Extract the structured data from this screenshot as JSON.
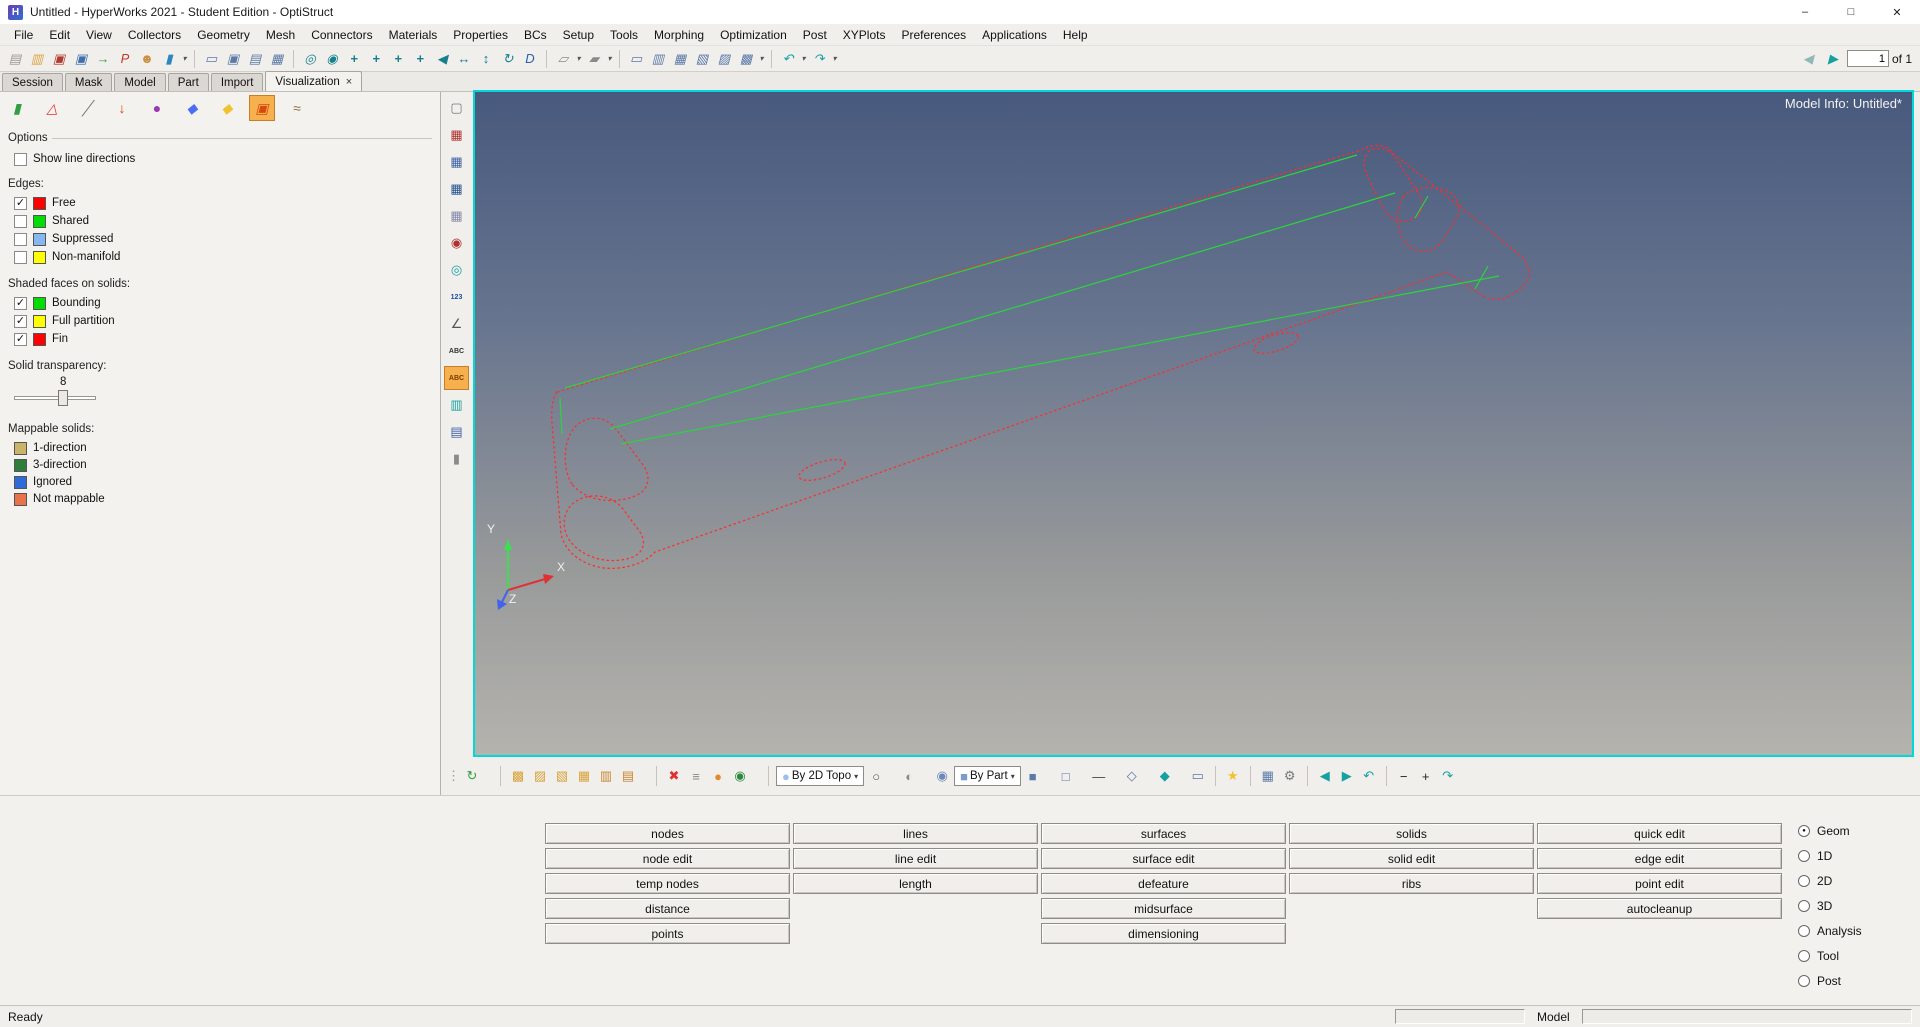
{
  "window": {
    "title": "Untitled - HyperWorks 2021 - Student Edition - OptiStruct",
    "controls": {
      "minimize": "–",
      "maximize": "□",
      "close": "✕"
    }
  },
  "menu": {
    "items": [
      "File",
      "Edit",
      "View",
      "Collectors",
      "Geometry",
      "Mesh",
      "Connectors",
      "Materials",
      "Properties",
      "BCs",
      "Setup",
      "Tools",
      "Morphing",
      "Optimization",
      "Post",
      "XYPlots",
      "Preferences",
      "Applications",
      "Help"
    ]
  },
  "toolbar": {
    "icons": [
      {
        "n": "new-session-icon",
        "g": "▤",
        "c": "#9a9791"
      },
      {
        "n": "open-model-icon",
        "g": "▥",
        "c": "#d9a33b"
      },
      {
        "n": "save-model-icon",
        "g": "▣",
        "c": "#b23a2e"
      },
      {
        "n": "save-as-icon",
        "g": "▣",
        "c": "#3f6fae"
      },
      {
        "n": "import-solver-deck-icon",
        "g": "→",
        "c": "#2f9e44"
      },
      {
        "n": "export-ppt-icon",
        "g": "P",
        "c": "#c0392b"
      },
      {
        "n": "user-profiles-icon",
        "g": "☻",
        "c": "#c98e3f"
      },
      {
        "n": "report-icon",
        "g": "▮",
        "c": "#2e86c1"
      },
      {
        "n": "dropdown-caret",
        "g": "▾",
        "c": "#555",
        "cls": "caret"
      },
      {
        "n": "separator",
        "cls": "sep",
        "ia": "false"
      },
      {
        "n": "copy-window-icon",
        "g": "▭",
        "c": "#5b7aa8"
      },
      {
        "n": "capture-screen-icon",
        "g": "▣",
        "c": "#5b7aa8"
      },
      {
        "n": "screen-grab-icon",
        "g": "▤",
        "c": "#5b7aa8"
      },
      {
        "n": "print-icon",
        "g": "▦",
        "c": "#5b7aa8"
      },
      {
        "n": "separator",
        "cls": "sep",
        "ia": "false"
      },
      {
        "n": "zoom-icon",
        "g": "◎",
        "c": "#16808c"
      },
      {
        "n": "smooth-zoom-icon",
        "g": "◉",
        "c": "#16808c"
      },
      {
        "n": "view-normal-icon",
        "g": "+",
        "c": "#16808c",
        "cls": "bold"
      },
      {
        "n": "view-top-icon",
        "g": "+",
        "c": "#16808c",
        "cls": "bold"
      },
      {
        "n": "view-left-icon",
        "g": "+",
        "c": "#16808c",
        "cls": "bold"
      },
      {
        "n": "view-iso-icon",
        "g": "+",
        "c": "#16808c",
        "cls": "bold"
      },
      {
        "n": "arrow-pan-icon",
        "g": "◀",
        "c": "#16808c"
      },
      {
        "n": "pan-horizontal-icon",
        "g": "↔",
        "c": "#16808c"
      },
      {
        "n": "pan-vertical-icon",
        "g": "↕",
        "c": "#16808c"
      },
      {
        "n": "rotate-view-icon",
        "g": "↻",
        "c": "#16808c"
      },
      {
        "n": "true-view-icon",
        "g": "D",
        "c": "#2e5fae"
      },
      {
        "n": "separator",
        "cls": "sep",
        "ia": "false"
      },
      {
        "n": "copy-image-icon",
        "g": "▱",
        "c": "#8a8a8a"
      },
      {
        "n": "dropdown-caret",
        "g": "▾",
        "c": "#555",
        "cls": "caret"
      },
      {
        "n": "paste-image-icon",
        "g": "▰",
        "c": "#8a8a8a"
      },
      {
        "n": "dropdown-caret",
        "g": "▾",
        "c": "#555",
        "cls": "caret"
      },
      {
        "n": "separator",
        "cls": "sep",
        "ia": "false"
      },
      {
        "n": "layout-single-icon",
        "g": "▭",
        "c": "#5b7aa8"
      },
      {
        "n": "layout-split-icon",
        "g": "▥",
        "c": "#5b7aa8"
      },
      {
        "n": "layout-quad-icon",
        "g": "▦",
        "c": "#5b7aa8"
      },
      {
        "n": "swap-window-icon",
        "g": "▧",
        "c": "#5b7aa8"
      },
      {
        "n": "expand-window-icon",
        "g": "▨",
        "c": "#5b7aa8"
      },
      {
        "n": "record-icon",
        "g": "▩",
        "c": "#5b7aa8"
      },
      {
        "n": "dropdown-caret",
        "g": "▾",
        "c": "#555",
        "cls": "caret"
      },
      {
        "n": "separator",
        "cls": "sep",
        "ia": "false"
      },
      {
        "n": "undo-icon",
        "g": "↶",
        "c": "#16a0a0"
      },
      {
        "n": "dropdown-caret",
        "g": "▾",
        "c": "#555",
        "cls": "caret"
      },
      {
        "n": "redo-icon",
        "g": "↷",
        "c": "#16a0a0"
      },
      {
        "n": "dropdown-caret",
        "g": "▾",
        "c": "#555",
        "cls": "caret"
      }
    ],
    "prev_glyph": "◀",
    "next_glyph": "▶",
    "page_value": "1",
    "page_total": "of 1"
  },
  "tabs": {
    "items": [
      "Session",
      "Mask",
      "Model",
      "Part",
      "Import",
      "Visualization"
    ],
    "close": "×"
  },
  "vizbar": {
    "icons": [
      {
        "n": "display-geometry-icon",
        "g": "▮",
        "c": "#2f9e44"
      },
      {
        "n": "display-elements-icon",
        "g": "△",
        "c": "#e03131"
      },
      {
        "n": "display-lines-icon",
        "g": "╱",
        "c": "#777777"
      },
      {
        "n": "display-loads-icon",
        "g": "↓",
        "c": "#d9480f"
      },
      {
        "n": "display-morphing-icon",
        "g": "●",
        "c": "#9c36b5"
      },
      {
        "n": "display-systems-icon",
        "g": "◆",
        "c": "#4c6ef5"
      },
      {
        "n": "display-tags-icon",
        "g": "◆",
        "c": "#f0c22e"
      },
      {
        "n": "visualization-settings-icon",
        "g": "▣",
        "c": "#d9480f",
        "cls": "active"
      },
      {
        "n": "cleanup-tools-icon",
        "g": "≈",
        "c": "#8a7040"
      }
    ]
  },
  "viz": {
    "options_title": "Options",
    "show_line_directions": {
      "label": "Show line directions",
      "check": ""
    },
    "edges_title": "Edges:",
    "edges": [
      {
        "label": "Free",
        "color": "#ff0000",
        "check": "✓"
      },
      {
        "label": "Shared",
        "color": "#00dd00",
        "check": ""
      },
      {
        "label": "Suppressed",
        "color": "#86b8f0",
        "check": ""
      },
      {
        "label": "Non-manifold",
        "color": "#ffff00",
        "check": ""
      }
    ],
    "shaded_title": "Shaded faces on solids:",
    "shaded": [
      {
        "label": "Bounding",
        "color": "#00dd00",
        "check": "✓"
      },
      {
        "label": "Full partition",
        "color": "#ffff00",
        "check": "✓"
      },
      {
        "label": "Fin",
        "color": "#ff0000",
        "check": "✓"
      }
    ],
    "transparency_title": "Solid transparency:",
    "transparency_value": "8",
    "mappable_title": "Mappable solids:",
    "mappable": [
      {
        "label": "1-direction",
        "color": "#c9b46a"
      },
      {
        "label": "3-direction",
        "color": "#2e7d3a"
      },
      {
        "label": "Ignored",
        "color": "#2f6bd8"
      },
      {
        "label": "Not mappable",
        "color": "#e8734a"
      }
    ]
  },
  "vstrip": {
    "icons": [
      {
        "n": "selection-options-icon",
        "g": "▢",
        "c": "#777777"
      },
      {
        "n": "mesh-display-red-icon",
        "g": "▦",
        "c": "#b03030"
      },
      {
        "n": "mesh-display-blue-icon",
        "g": "▦",
        "c": "#3a5fa8"
      },
      {
        "n": "mesh-display-dark-icon",
        "g": "▦",
        "c": "#24508c"
      },
      {
        "n": "mesh-display-shaded-icon",
        "g": "▦",
        "c": "#8888aa"
      },
      {
        "n": "spherical-clip-icon",
        "g": "◉",
        "c": "#b03030"
      },
      {
        "n": "rotate-center-icon",
        "g": "◎",
        "c": "#16a0a0"
      },
      {
        "n": "numbers-display-icon",
        "g": "123",
        "c": "#1a4f9c",
        "cls": "small"
      },
      {
        "n": "measures-icon",
        "g": "∠",
        "c": "#555555"
      },
      {
        "n": "labels-icon",
        "g": "ABC",
        "c": "#333333",
        "cls": "small"
      },
      {
        "n": "labels-active-icon",
        "g": "ABC",
        "c": "#7a3b00",
        "cls": "small active"
      },
      {
        "n": "section-cut-icon",
        "g": "▥",
        "c": "#16a0a0"
      },
      {
        "n": "clipping-icon",
        "g": "▤",
        "c": "#3a5fa8"
      },
      {
        "n": "solid-display-icon",
        "g": "▮",
        "c": "#8a8a8a"
      }
    ]
  },
  "viewport": {
    "model_info": "Model Info: Untitled*",
    "axis": {
      "x": "X",
      "y": "Y",
      "z": "Z"
    },
    "edge_colors": {
      "free": "#ff2b2b",
      "shared": "#2bd53c"
    }
  },
  "vtoolbar": {
    "items": [
      {
        "n": "toolbar-handle",
        "g": "⋮",
        "c": "#9a9a9a",
        "cls": "handle",
        "ia": "false"
      },
      {
        "n": "selector-settings-icon",
        "g": "↻",
        "c": "#2f9e44"
      },
      {
        "n": "dropdown-caret",
        "g": "▾",
        "c": "#444",
        "cls": "caret"
      },
      {
        "n": "separator",
        "cls": "sep",
        "ia": "false"
      },
      {
        "n": "show-hide-icon",
        "g": "▩",
        "c": "#d9a33b"
      },
      {
        "n": "unmask-adjacent-icon",
        "g": "▨",
        "c": "#d9a33b"
      },
      {
        "n": "unmask-all-icon",
        "g": "▧",
        "c": "#d9a33b"
      },
      {
        "n": "reverse-mask-icon",
        "g": "▦",
        "c": "#d9a33b"
      },
      {
        "n": "isolate-icon",
        "g": "▥",
        "c": "#c9862e"
      },
      {
        "n": "mask-panel-icon",
        "g": "▤",
        "c": "#c9862e"
      },
      {
        "n": "dropdown-caret",
        "g": "▾",
        "c": "#444",
        "cls": "caret"
      },
      {
        "n": "separator",
        "cls": "sep",
        "ia": "false"
      },
      {
        "n": "delete-icon",
        "g": "✖",
        "c": "#e03131"
      },
      {
        "n": "organize-icon",
        "g": "≡",
        "c": "#8a8a8a"
      },
      {
        "n": "color-icon",
        "g": "●",
        "c": "#e8882a"
      },
      {
        "n": "count-icon",
        "g": "◉",
        "c": "#2b8a3e"
      },
      {
        "n": "dropdown-caret",
        "g": "▾",
        "c": "#444",
        "cls": "caret"
      },
      {
        "n": "separator",
        "cls": "sep",
        "ia": "false"
      },
      {
        "n": "geometry-color-mode-select",
        "g": "●",
        "c": "#9cc0e8",
        "label": "By 2D Topo",
        "caret": "▾",
        "cls": "combo"
      },
      {
        "n": "geometry-wireframe-style-icon",
        "g": "○",
        "c": "#555555"
      },
      {
        "n": "dropdown-caret",
        "g": "▾",
        "c": "#444",
        "cls": "caret"
      },
      {
        "n": "geometry-shaded-style-icon",
        "g": "◐",
        "c": "#8a8a8a"
      },
      {
        "n": "dropdown-caret",
        "g": "▾",
        "c": "#444",
        "cls": "caret"
      },
      {
        "n": "geometry-mesh-style-icon",
        "g": "◉",
        "c": "#6a8ab8"
      },
      {
        "n": "element-color-mode-select",
        "g": "■",
        "c": "#7c9cc8",
        "label": "By Part",
        "caret": "▾",
        "cls": "combo"
      },
      {
        "n": "element-shaded-style-icon",
        "g": "■",
        "c": "#5b7aa8"
      },
      {
        "n": "dropdown-caret",
        "g": "▾",
        "c": "#444",
        "cls": "caret"
      },
      {
        "n": "element-wireframe-style-icon",
        "g": "□",
        "c": "#5b7aa8"
      },
      {
        "n": "dropdown-caret",
        "g": "▾",
        "c": "#444",
        "cls": "caret"
      },
      {
        "n": "element-1d-style-icon",
        "g": "—",
        "c": "#444444"
      },
      {
        "n": "dropdown-caret",
        "g": "▾",
        "c": "#444",
        "cls": "caret"
      },
      {
        "n": "shrink-elements-icon",
        "g": "◇",
        "c": "#5b7aa8"
      },
      {
        "n": "dropdown-caret",
        "g": "▾",
        "c": "#444",
        "cls": "caret"
      },
      {
        "n": "feature-angle-icon",
        "g": "◆",
        "c": "#16a0a0"
      },
      {
        "n": "dropdown-caret",
        "g": "▾",
        "c": "#444",
        "cls": "caret"
      },
      {
        "n": "performance-graphics-icon",
        "g": "▭",
        "c": "#5b7aa8"
      },
      {
        "n": "separator",
        "cls": "sep",
        "ia": "false"
      },
      {
        "n": "favorites-icon",
        "g": "★",
        "c": "#f0c22e"
      },
      {
        "n": "separator",
        "cls": "sep",
        "ia": "false"
      },
      {
        "n": "browser-layout-icon",
        "g": "▦",
        "c": "#5b7aa8"
      },
      {
        "n": "options-icon",
        "g": "⚙",
        "c": "#777777"
      },
      {
        "n": "separator",
        "cls": "sep",
        "ia": "false"
      },
      {
        "n": "previous-view-icon",
        "g": "◀",
        "c": "#16a0a0"
      },
      {
        "n": "next-view-icon",
        "g": "▶",
        "c": "#16a0a0"
      },
      {
        "n": "restore-view-icon",
        "g": "↶",
        "c": "#16a0a0"
      },
      {
        "n": "separator",
        "cls": "sep",
        "ia": "false"
      },
      {
        "n": "zoom-out-icon",
        "g": "−",
        "c": "#222222"
      },
      {
        "n": "zoom-in-icon",
        "g": "+",
        "c": "#222222"
      },
      {
        "n": "fit-model-icon",
        "g": "↷",
        "c": "#16a0a0"
      }
    ]
  },
  "panel": {
    "columns": [
      [
        "nodes",
        "node edit",
        "temp nodes",
        "distance",
        "points"
      ],
      [
        "lines",
        "line edit",
        "length"
      ],
      [
        "surfaces",
        "surface edit",
        "defeature",
        "midsurface",
        "dimensioning"
      ],
      [
        "solids",
        "solid edit",
        "ribs"
      ],
      [
        "quick edit",
        "edge edit",
        "point edit",
        "autocleanup"
      ]
    ],
    "modes": [
      {
        "label": "Geom",
        "dot": "●"
      },
      {
        "label": "1D",
        "dot": ""
      },
      {
        "label": "2D",
        "dot": ""
      },
      {
        "label": "3D",
        "dot": ""
      },
      {
        "label": "Analysis",
        "dot": ""
      },
      {
        "label": "Tool",
        "dot": ""
      },
      {
        "label": "Post",
        "dot": ""
      }
    ]
  },
  "statusbar": {
    "ready": "Ready",
    "model_label": "Model"
  }
}
